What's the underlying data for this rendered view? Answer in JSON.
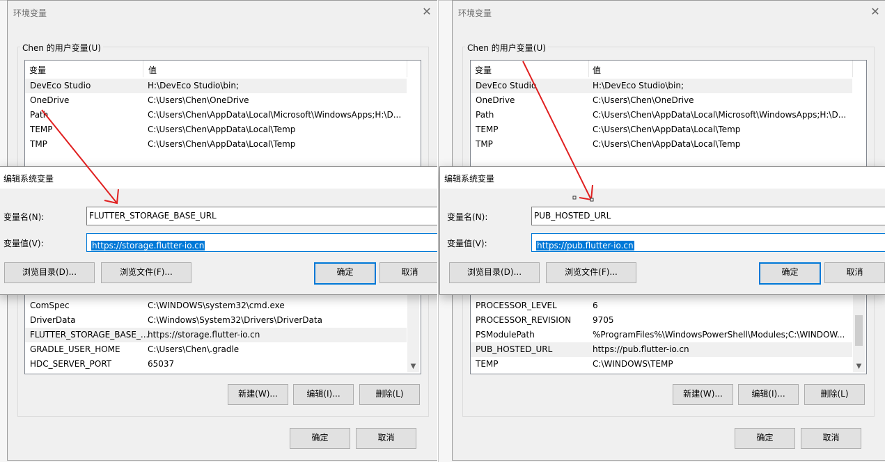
{
  "left": {
    "env_title": "环境变量",
    "close_glyph": "✕",
    "user_group_label": "Chen 的用户变量(U)",
    "user_columns": [
      "变量",
      "值"
    ],
    "user_vars": [
      {
        "name": "DevEco Studio",
        "value": "H:\\DevEco Studio\\bin;"
      },
      {
        "name": "OneDrive",
        "value": "C:\\Users\\Chen\\OneDrive"
      },
      {
        "name": "Path",
        "value": "C:\\Users\\Chen\\AppData\\Local\\Microsoft\\WindowsApps;H:\\D..."
      },
      {
        "name": "TEMP",
        "value": "C:\\Users\\Chen\\AppData\\Local\\Temp"
      },
      {
        "name": "TMP",
        "value": "C:\\Users\\Chen\\AppData\\Local\\Temp"
      }
    ],
    "sys_vars": [
      {
        "name": "ComSpec",
        "value": "C:\\WINDOWS\\system32\\cmd.exe"
      },
      {
        "name": "DriverData",
        "value": "C:\\Windows\\System32\\Drivers\\DriverData"
      },
      {
        "name": "FLUTTER_STORAGE_BASE_...",
        "value": "https://storage.flutter-io.cn"
      },
      {
        "name": "GRADLE_USER_HOME",
        "value": "C:\\Users\\Chen\\.gradle"
      },
      {
        "name": "HDC_SERVER_PORT",
        "value": "65037"
      }
    ],
    "sys_buttons": {
      "new": "新建(W)...",
      "edit": "编辑(I)...",
      "delete": "删除(L)"
    },
    "footer": {
      "ok": "确定",
      "cancel": "取消"
    },
    "edit_dialog": {
      "title": "编辑系统变量",
      "name_label": "变量名(N):",
      "name_value": "FLUTTER_STORAGE_BASE_URL",
      "value_label": "变量值(V):",
      "value_value": "https://storage.flutter-io.cn",
      "browse_dir": "浏览目录(D)...",
      "browse_file": "浏览文件(F)...",
      "ok": "确定",
      "cancel": "取消"
    }
  },
  "right": {
    "env_title": "环境变量",
    "close_glyph": "✕",
    "user_group_label": "Chen 的用户变量(U)",
    "user_columns": [
      "变量",
      "值"
    ],
    "user_vars": [
      {
        "name": "DevEco Studio",
        "value": "H:\\DevEco Studio\\bin;"
      },
      {
        "name": "OneDrive",
        "value": "C:\\Users\\Chen\\OneDrive"
      },
      {
        "name": "Path",
        "value": "C:\\Users\\Chen\\AppData\\Local\\Microsoft\\WindowsApps;H:\\D..."
      },
      {
        "name": "TEMP",
        "value": "C:\\Users\\Chen\\AppData\\Local\\Temp"
      },
      {
        "name": "TMP",
        "value": "C:\\Users\\Chen\\AppData\\Local\\Temp"
      }
    ],
    "sys_vars": [
      {
        "name": "PROCESSOR_LEVEL",
        "value": "6"
      },
      {
        "name": "PROCESSOR_REVISION",
        "value": "9705"
      },
      {
        "name": "PSModulePath",
        "value": "%ProgramFiles%\\WindowsPowerShell\\Modules;C:\\WINDOW..."
      },
      {
        "name": "PUB_HOSTED_URL",
        "value": "https://pub.flutter-io.cn"
      },
      {
        "name": "TEMP",
        "value": "C:\\WINDOWS\\TEMP"
      }
    ],
    "sys_buttons": {
      "new": "新建(W)...",
      "edit": "编辑(I)...",
      "delete": "删除(L)"
    },
    "footer": {
      "ok": "确定",
      "cancel": "取消"
    },
    "edit_dialog": {
      "title": "编辑系统变量",
      "name_label": "变量名(N):",
      "name_value": "PUB_HOSTED_URL",
      "value_label": "变量值(V):",
      "value_value": "https://pub.flutter-io.cn",
      "browse_dir": "浏览目录(D)...",
      "browse_file": "浏览文件(F)...",
      "ok": "确定",
      "cancel": "取消"
    }
  },
  "colors": {
    "annotation_arrow": "#e02020",
    "accent": "#0078d7"
  },
  "scroll_glyphs": {
    "up": "▲",
    "down": "▼"
  }
}
